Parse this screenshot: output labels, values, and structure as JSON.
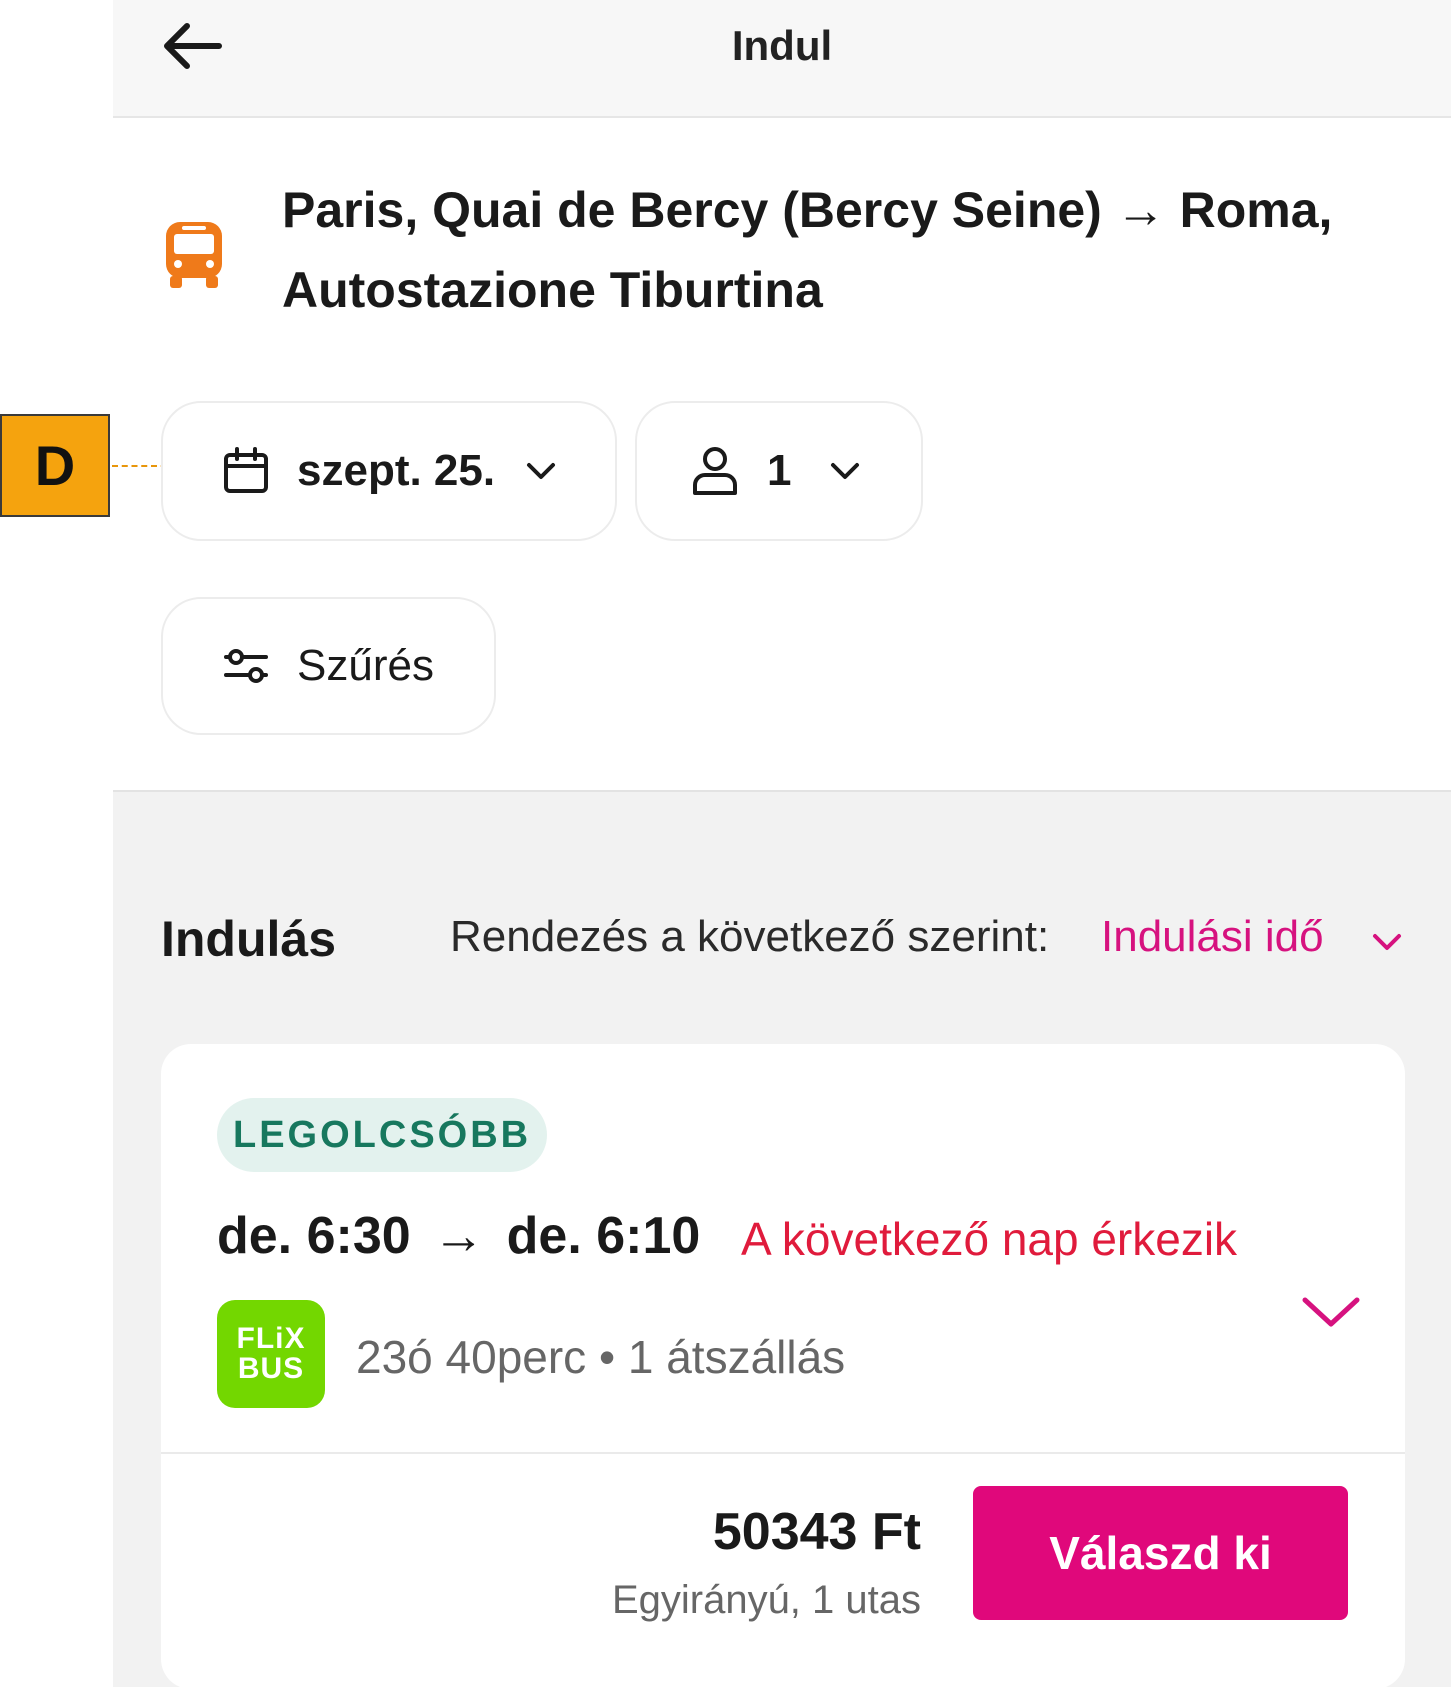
{
  "header": {
    "title": "Indul"
  },
  "route": {
    "text": "Paris, Quai de Bercy (Bercy Seine) → Roma, Autostazione Tiburtina"
  },
  "marker": {
    "label": "D"
  },
  "search": {
    "date": "szept. 25.",
    "passengers": "1",
    "filter_label": "Szűrés"
  },
  "results": {
    "title": "Indulás",
    "sort_label": "Rendezés a következő szerint:",
    "sort_value": "Indulási idő"
  },
  "trip": {
    "badge": "LEGOLCSÓBB",
    "departure": "de. 6:30",
    "arrow": "→",
    "arrival": "de. 6:10",
    "next_day_note": "A következő nap érkezik",
    "operator_line1": "FLiX",
    "operator_line2": "BUS",
    "duration": "23ó 40perc • 1 átszállás",
    "price": "50343 Ft",
    "price_note": "Egyirányú, 1 utas",
    "select_label": "Válaszd ki"
  },
  "colors": {
    "accent": "#e0087b",
    "bus_icon": "#ef7a1a",
    "flixbus": "#73d700",
    "next_day": "#e01b3c",
    "badge_text": "#17785e"
  },
  "icons": [
    "back-arrow-icon",
    "bus-icon",
    "calendar-icon",
    "chevron-down-icon",
    "person-icon",
    "filter-sliders-icon"
  ]
}
